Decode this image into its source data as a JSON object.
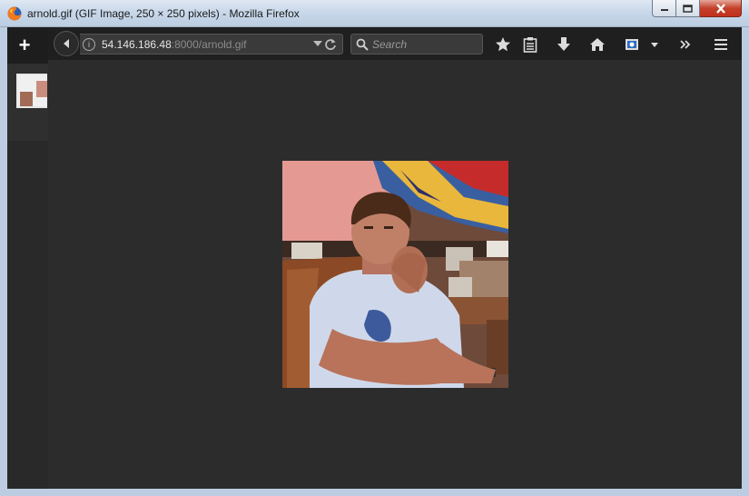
{
  "window": {
    "title": "arnold.gif (GIF Image, 250 × 250 pixels) - Mozilla Firefox"
  },
  "tabs": {
    "new_tab_label": "+"
  },
  "navbar": {
    "url_host": "54.146.186.48",
    "url_rest": ":8000/arnold.gif",
    "search_placeholder": "Search"
  },
  "icons": {
    "back": "back-arrow-icon",
    "info": "info-icon",
    "url_dropdown": "chevron-down-icon",
    "reload": "reload-icon",
    "search": "search-icon",
    "bookmark": "star-icon",
    "reading_list": "clipboard-icon",
    "downloads": "download-icon",
    "home": "home-icon",
    "screenshot": "screenshot-icon",
    "overflow": "double-chevron-icon",
    "menu": "hamburger-menu-icon"
  },
  "colors": {
    "chrome_dark": "#1f1f1f",
    "content_bg": "#2c2c2c",
    "titlebar": "#c9d8ea",
    "close_red": "#c4402a"
  }
}
